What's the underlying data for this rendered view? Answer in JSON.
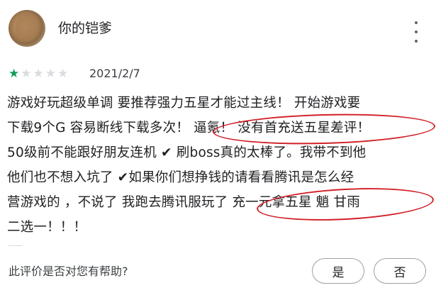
{
  "review": {
    "username": "你的铠爹",
    "rating": 1,
    "max_rating": 5,
    "date": "2021/2/7",
    "lines": [
      "游戏好玩超级单调 要推荐强力五星才能过主线！ 开始游戏要",
      "下载9个G 容易断线下载多次！ 逼氪！ 没有首充送五星差评！",
      "50级前不能跟好朋友连机 ✔ 刷boss真的太棒了。我带不到他",
      "他们也不想入坑了 ✔如果你们想挣钱的请看看腾讯是怎么经",
      "营游戏的 ，不说了 我跑去腾讯服玩了 充一元拿五星 魈 甘雨",
      "二选一！！！"
    ]
  },
  "feedback": {
    "question": "此评价是否对您有帮助?",
    "yes_label": "是",
    "no_label": "否"
  },
  "colors": {
    "star_filled": "#0f9d58",
    "star_empty": "#dadce0",
    "annotation": "#d21f26"
  },
  "icons": {
    "more": "more-vert-icon",
    "star": "star-icon"
  }
}
